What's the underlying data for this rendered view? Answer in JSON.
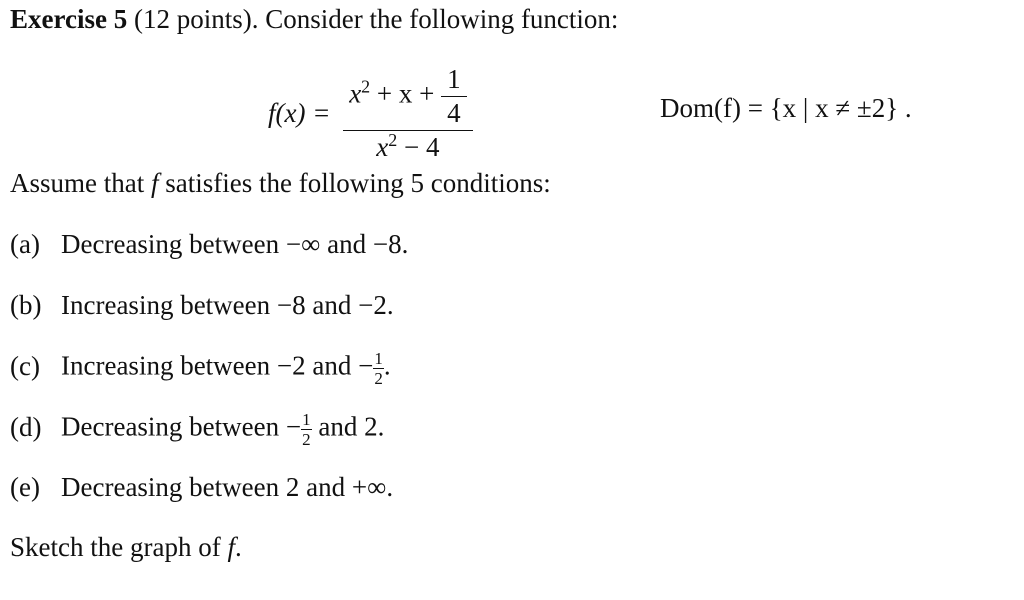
{
  "header": {
    "exercise": "Exercise 5",
    "points": "(12 points).",
    "intro": "Consider the following function:"
  },
  "formula": {
    "lhs": "f(x) =",
    "numerator": {
      "x": "x",
      "exp": "2",
      "rest": " + x + ",
      "frac_num": "1",
      "frac_den": "4"
    },
    "denominator": {
      "x": "x",
      "exp": "2",
      "rest": " − 4"
    },
    "domain": "Dom(f) = {x | x ≠ ±2} ."
  },
  "assume": {
    "prefix": "Assume that ",
    "f": "f",
    "suffix": " satisfies the following 5 conditions:"
  },
  "conditions": [
    {
      "label": "(a)",
      "text": "Decreasing between −∞ and −8."
    },
    {
      "label": "(b)",
      "text": "Increasing between −8 and −2."
    },
    {
      "label": "(c)",
      "text": "Increasing between −2 and −",
      "frac_num": "1",
      "frac_den": "2",
      "tail": "."
    },
    {
      "label": "(d)",
      "text": "Decreasing between −",
      "frac_num": "1",
      "frac_den": "2",
      "tail": " and 2."
    },
    {
      "label": "(e)",
      "text": "Decreasing between 2 and +∞."
    }
  ],
  "closing": {
    "prefix": "Sketch the graph of ",
    "f": "f",
    "suffix": "."
  }
}
